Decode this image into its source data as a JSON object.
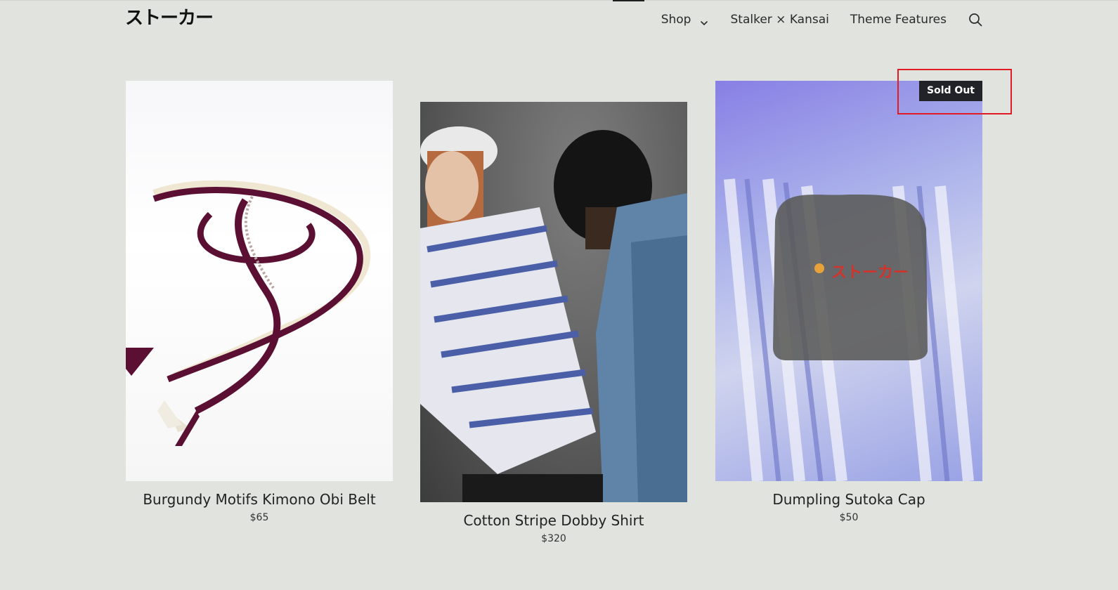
{
  "header": {
    "logo_text": "ストーカー",
    "nav": [
      {
        "label": "Shop",
        "has_dropdown": true,
        "icon": "chevron-down-icon"
      },
      {
        "label": "Stalker × Kansai"
      },
      {
        "label": "Theme Features"
      }
    ],
    "search_icon": "search-icon"
  },
  "products": [
    {
      "title": "Burgundy Motifs Kimono Obi Belt",
      "price": "$65",
      "badge": ""
    },
    {
      "title": "Cotton Stripe Dobby Shirt",
      "price": "$320",
      "badge": ""
    },
    {
      "title": "Dumpling Sutoka Cap",
      "price": "$50",
      "badge": "Sold Out",
      "cap_print": "ストーカー"
    }
  ],
  "colors": {
    "background": "#e1e3de",
    "text": "#1e1e1e",
    "badge_bg": "#222229",
    "badge_text": "#ffffff",
    "highlight": "#e01b24"
  }
}
